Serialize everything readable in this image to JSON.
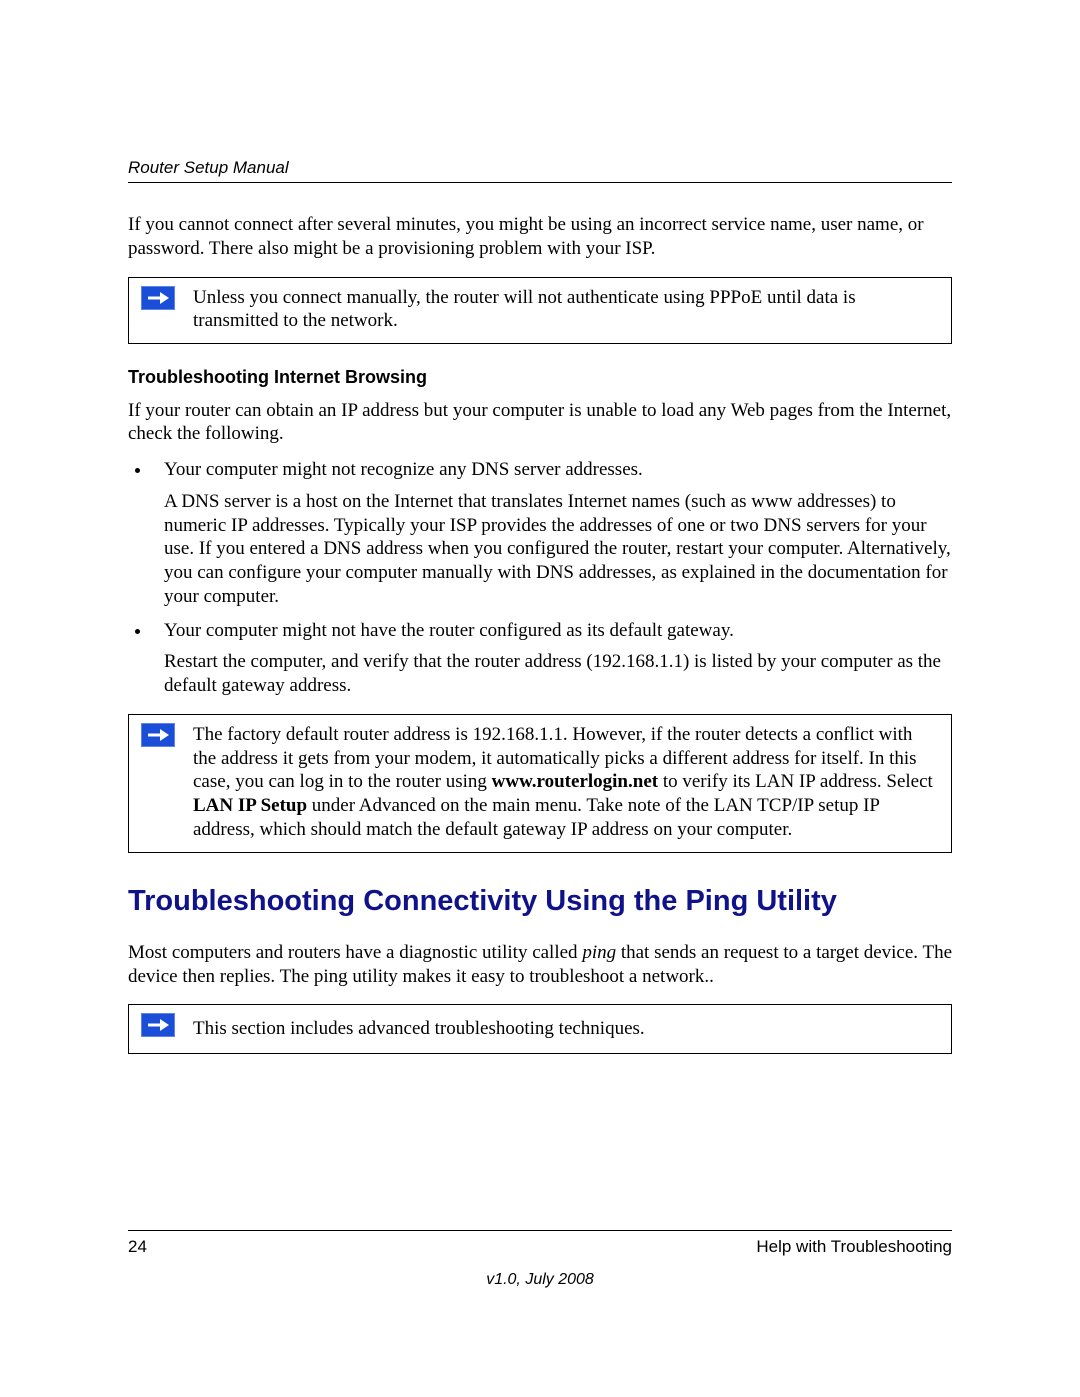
{
  "header": {
    "running_title": "Router Setup Manual"
  },
  "intro_para": "If you cannot connect after several minutes, you might be using an incorrect service name, user name, or password. There also might be a provisioning problem with your ISP.",
  "note1": "Unless you connect manually, the router will not authenticate using PPPoE until data is transmitted to the network.",
  "subheading1": "Troubleshooting Internet Browsing",
  "sub1_intro": "If your router can obtain an IP address but your computer is unable to load any Web pages from the Internet, check the following.",
  "bullets": {
    "b1": "Your computer might not recognize any DNS server addresses.",
    "b1_follow": "A DNS server is a host on the Internet that translates Internet names (such as www addresses) to numeric IP addresses. Typically your ISP provides the addresses of one or two DNS servers for your use. If you entered a DNS address when you configured the router, restart your computer. Alternatively, you can configure your computer manually with DNS addresses, as explained in the documentation for your computer.",
    "b2": "Your computer might not have the router configured as its default gateway.",
    "b2_follow": "Restart the computer, and verify that the router address (192.168.1.1) is listed by your computer as the default gateway address."
  },
  "note2": {
    "part1": "The factory default router address is 192.168.1.1. However, if the router detects a conflict with the address it gets from your modem, it automatically picks a different address for itself. In this case, you can log in to the router using ",
    "bold_url": "www.routerlogin.net",
    "part2": " to verify its LAN IP address. Select ",
    "bold_menu": "LAN IP Setup",
    "part3": " under Advanced on the main menu. Take note of the LAN TCP/IP setup IP address, which should match the default gateway IP address on your computer."
  },
  "major_heading": "Troubleshooting Connectivity Using the Ping Utility",
  "ping_para": {
    "pre": "Most computers and routers have a diagnostic utility called ",
    "ital": "ping",
    "post": " that sends an request to a target device. The device then replies. The ping utility makes it easy to troubleshoot a network.."
  },
  "note3": "This section includes advanced troubleshooting techniques.",
  "footer": {
    "page_number": "24",
    "section": "Help with Troubleshooting",
    "version": "v1.0, July 2008"
  }
}
